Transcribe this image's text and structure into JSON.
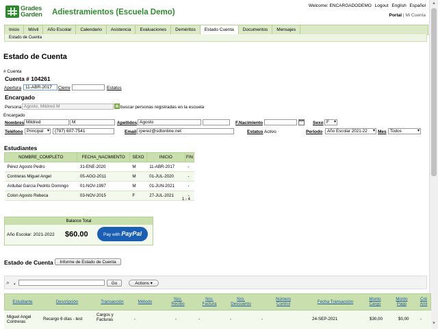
{
  "header": {
    "logo_line1": "Grades",
    "logo_line2": "Garden",
    "app_title": "Adiestramientos (Escuela Demo)",
    "welcome": "Welcome: ENCARGADODEMO",
    "logout": "Logout",
    "lang_en": "English",
    "lang_es": "Español",
    "portal": "Portal",
    "portal_sep": "|",
    "mi_cuenta": "Mi Cuenta"
  },
  "nav": {
    "items": [
      "Inicio",
      "Móvil",
      "Año Escolar",
      "Calendario",
      "Asistencia",
      "Evaluaciones",
      "Deméritos",
      "Estado Cuenta",
      "Documentos",
      "Mensajes"
    ],
    "active": "Estado Cuenta",
    "sub": "Estado de Cuenta"
  },
  "page": {
    "title": "Estado de Cuenta",
    "num_cuenta_label": "# Cuenta",
    "cuenta_heading": "Cuenta # 104261",
    "apertura_label": "Apertura",
    "apertura_value": "11-ABR-2017",
    "cierre_label": "Cierre",
    "cierre_value": "",
    "estatus_label": "Estatus",
    "encargado_heading": "Encargado",
    "persona_label": "Persona",
    "persona_value": "Agosto, Mildred M",
    "buscar_text": "buscar personas registradas en la escuela",
    "encargado_label": "Encargado",
    "nombres_label": "Nombres",
    "nombres_value": "Mildred",
    "inicial_value": "M",
    "apellidos_label": "Apellidos",
    "apellido1_value": "Agosto",
    "apellido2_value": "",
    "fnac_label": "F.Nacimiento",
    "fnac_value": "",
    "sexo_label": "Sexo",
    "sexo_value": "F",
    "telefono_label": "Teléfono",
    "telefono_tipo": "Principal",
    "telefono_value": "(787) 607-7541",
    "email_label": "Email",
    "email_value": "rperez@sdtonline.net",
    "estatus2_label": "Estatus",
    "estatus2_value": "Activo",
    "periodo_label": "Periodo",
    "periodo_value": "Año Escolar 2021-22",
    "mes_label": "Mes",
    "mes_value": "Todos"
  },
  "students": {
    "heading": "Estudiantes",
    "columns": [
      "NOMBRE_COMPLETO",
      "FECHA_NACIMIENTO",
      "SEXO",
      "INICIO",
      "FIN"
    ],
    "rows": [
      [
        "Pérez Agosto Pedro",
        "31-ENE-2020",
        "M",
        "11-ABR-2017",
        "-"
      ],
      [
        "Contreras Miguel Angel",
        "05-AGO-2011",
        "M",
        "01-JUL-2020",
        "-"
      ],
      [
        "Ardubal García Pedrito Domingo",
        "01-NOV-1997",
        "M",
        "01-JUN-2021",
        "-"
      ],
      [
        "Colon Agosto Rebeca",
        "03-NOV-2015",
        "F",
        "27-JUL-2021",
        "-"
      ]
    ],
    "pagination": "1 - 4"
  },
  "balance": {
    "header": "Balance Total",
    "label": "Año Escolar: 2021-2022",
    "amount": "$60.00",
    "paypal_prefix": "Pay with",
    "paypal_brand": "PayPal"
  },
  "statement": {
    "heading": "Estado de Cuenta",
    "informe_button": "Informe de Estado de Cuenta",
    "go_button": "Go",
    "actions_button": "Actions",
    "search_value": ""
  },
  "transactions": {
    "columns": [
      "Estudiante",
      "Descripción",
      "Transacción",
      "Método",
      "Nro. Recibo",
      "Nro. Factura",
      "Nro. Descuento",
      "Número Control",
      "Fecha Transacción",
      "Monto Cargo",
      "Monto Pago",
      "Cré Ami"
    ],
    "rows": [
      [
        "Miguel Angel Contreras",
        "Recargo 6 días - test",
        "Cargos y Facturas",
        "-",
        "-",
        "-",
        "-",
        "-",
        "24-SEP-2021",
        "$30,00",
        "$0,00",
        "-"
      ]
    ]
  }
}
